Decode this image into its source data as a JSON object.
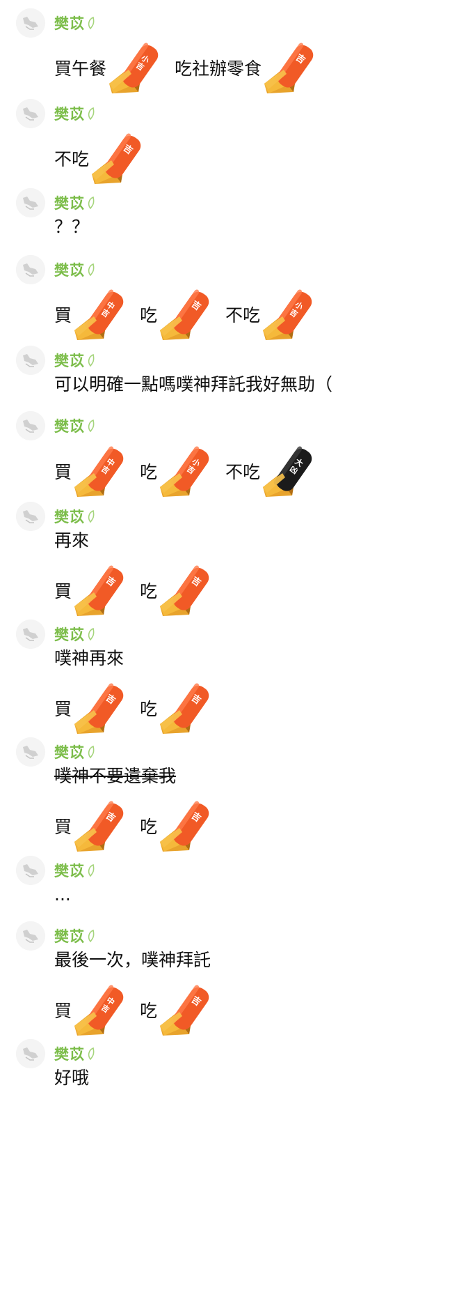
{
  "colors": {
    "name": "#7cbd4a",
    "text": "#111111",
    "lucky_stick": "#f15a26",
    "unlucky_stick": "#1b1b1b",
    "base": "#f4a321"
  },
  "messages": [
    {
      "sender": "樊苡",
      "lines": [
        [
          {
            "text": "買午餐",
            "stick": "小吉",
            "stick_color": "orange"
          },
          {
            "text": "吃社辦零食",
            "stick": "吉",
            "stick_color": "orange"
          }
        ]
      ]
    },
    {
      "sender": "樊苡",
      "lines": [
        [
          {
            "text": "不吃",
            "stick": "吉",
            "stick_color": "orange"
          }
        ]
      ]
    },
    {
      "sender": "樊苡",
      "lines": [
        [
          {
            "text": "？？"
          }
        ]
      ]
    },
    {
      "sender": "樊苡",
      "lines": [
        [
          {
            "text": "買",
            "stick": "中吉",
            "stick_color": "orange"
          },
          {
            "text": "吃",
            "stick": "吉",
            "stick_color": "orange"
          },
          {
            "text": "不吃",
            "stick": "小吉",
            "stick_color": "orange"
          }
        ]
      ]
    },
    {
      "sender": "樊苡",
      "lines": [
        [
          {
            "text": "可以明確一點嗎噗神拜託我好無助（"
          }
        ]
      ]
    },
    {
      "sender": "樊苡",
      "lines": [
        [
          {
            "text": "買",
            "stick": "中吉",
            "stick_color": "orange"
          },
          {
            "text": "吃",
            "stick": "小吉",
            "stick_color": "orange"
          },
          {
            "text": "不吃",
            "stick": "大凶",
            "stick_color": "black"
          }
        ]
      ]
    },
    {
      "sender": "樊苡",
      "lines": [
        [
          {
            "text": "再來"
          }
        ],
        [
          {
            "text": "買",
            "stick": "吉",
            "stick_color": "orange"
          },
          {
            "text": "吃",
            "stick": "吉",
            "stick_color": "orange"
          }
        ]
      ]
    },
    {
      "sender": "樊苡",
      "lines": [
        [
          {
            "text": "噗神再來"
          }
        ],
        [
          {
            "text": "買",
            "stick": "吉",
            "stick_color": "orange"
          },
          {
            "text": "吃",
            "stick": "吉",
            "stick_color": "orange"
          }
        ]
      ]
    },
    {
      "sender": "樊苡",
      "lines": [
        [
          {
            "text": "噗神不要遺棄我",
            "strike": true
          }
        ],
        [
          {
            "text": "買",
            "stick": "吉",
            "stick_color": "orange"
          },
          {
            "text": "吃",
            "stick": "吉",
            "stick_color": "orange"
          }
        ]
      ]
    },
    {
      "sender": "樊苡",
      "lines": [
        [
          {
            "text": "..."
          }
        ]
      ]
    },
    {
      "sender": "樊苡",
      "lines": [
        [
          {
            "text": "最後一次，噗神拜託"
          }
        ],
        [
          {
            "text": "買",
            "stick": "中吉",
            "stick_color": "orange"
          },
          {
            "text": "吃",
            "stick": "吉",
            "stick_color": "orange"
          }
        ]
      ]
    },
    {
      "sender": "樊苡",
      "lines": [
        [
          {
            "text": "好哦"
          }
        ]
      ]
    }
  ]
}
